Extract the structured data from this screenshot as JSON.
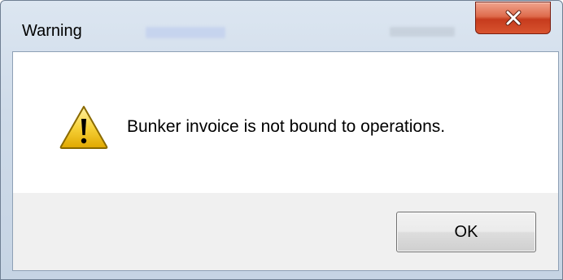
{
  "dialog": {
    "title": "Warning",
    "message": "Bunker invoice is not bound to operations.",
    "ok_label": "OK",
    "icon": "warning-icon",
    "close_icon": "close-icon"
  },
  "colors": {
    "close_button": "#d8532f",
    "frame": "#cfdbe9",
    "warning_triangle": "#f5c400"
  }
}
